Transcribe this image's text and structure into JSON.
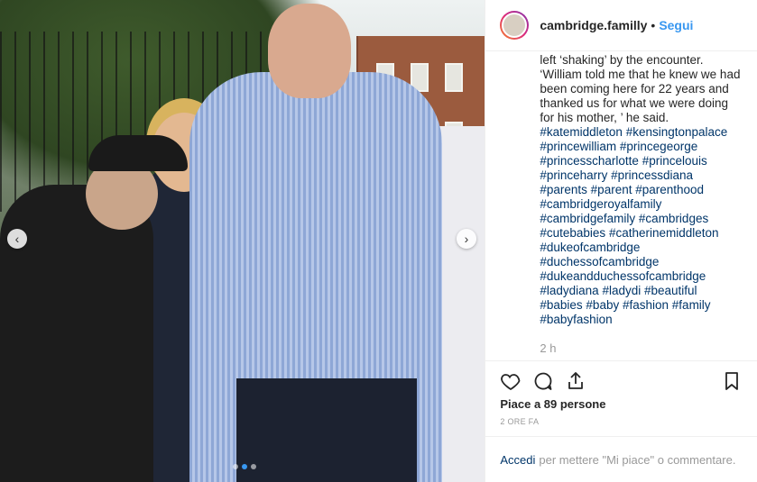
{
  "post": {
    "username": "cambridge.familly",
    "separator": "•",
    "follow_label": "Segui",
    "caption_text": "left ‘shaking’ by the encounter.\n‘William told me that he knew we had been coming here for 22 years and thanked us for what we were doing for his mother, ’ he said.",
    "hashtags": [
      "#katemiddleton",
      "#kensingtonpalace",
      "#princewilliam",
      "#princegeorge",
      "#princesscharlotte",
      "#princelouis",
      "#princeharry",
      "#princessdiana",
      "#parents",
      "#parent",
      "#parenthood",
      "#cambridgeroyalfamily",
      "#cambridgefamily",
      "#cambridges",
      "#cutebabies",
      "#catherinemiddleton",
      "#dukeofcambridge",
      "#duchessofcambridge",
      "#dukeandduchessofcambridge",
      "#ladydiana",
      "#ladydi",
      "#beautiful",
      "#babies",
      "#baby",
      "#fashion",
      "#family",
      "#babyfashion"
    ],
    "time_ago": "2 h",
    "likes_text": "Piace a 89 persone",
    "date_text": "2 ORE FA",
    "login_link": "Accedi",
    "comment_prompt": "per mettere \"Mi piace\" o commentare."
  },
  "media": {
    "prev_icon": "chevron-left-icon",
    "next_icon": "chevron-right-icon",
    "carousel_count": 3,
    "carousel_active": 1
  },
  "colors": {
    "link": "#3897f0",
    "hashtag": "#003569",
    "muted": "#999999"
  }
}
